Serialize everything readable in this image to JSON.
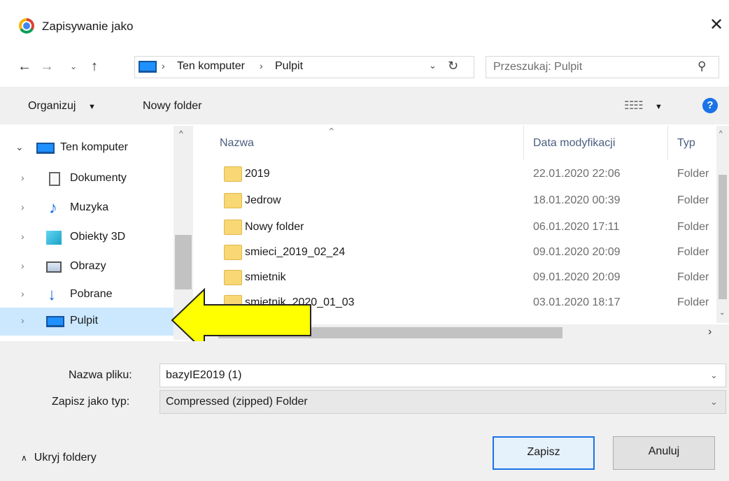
{
  "window": {
    "title": "Zapisywanie jako",
    "close": "✕"
  },
  "nav": {
    "back": "←",
    "forward": "→",
    "recent": "⌄",
    "up": "↑"
  },
  "address": {
    "crumbs": [
      "Ten komputer",
      "Pulpit"
    ],
    "separator": "›",
    "dropdown": "⌄",
    "refresh": "↻"
  },
  "search": {
    "placeholder": "Przeszukaj: Pulpit",
    "value": ""
  },
  "toolbar": {
    "organize": "Organizuj",
    "caret": "▼",
    "new_folder": "Nowy folder",
    "view": "☷☷"
  },
  "tree": {
    "root": "Ten komputer",
    "items": [
      {
        "label": "Dokumenty",
        "icon": "document-icon"
      },
      {
        "label": "Muzyka",
        "icon": "music-note-icon"
      },
      {
        "label": "Obiekty 3D",
        "icon": "cube-icon"
      },
      {
        "label": "Obrazy",
        "icon": "image-icon"
      },
      {
        "label": "Pobrane",
        "icon": "download-arrow-icon"
      },
      {
        "label": "Pulpit",
        "icon": "desktop-monitor-icon",
        "selected": true
      }
    ]
  },
  "columns": {
    "name": "Nazwa",
    "date": "Data modyfikacji",
    "type": "Typ"
  },
  "files": [
    {
      "name": "2019",
      "date": "22.01.2020 22:06",
      "type": "Folder"
    },
    {
      "name": "Jedrow",
      "date": "18.01.2020 00:39",
      "type": "Folder"
    },
    {
      "name": "Nowy folder",
      "date": "06.01.2020 17:11",
      "type": "Folder"
    },
    {
      "name": "smieci_2019_02_24",
      "date": "09.01.2020 20:09",
      "type": "Folder"
    },
    {
      "name": "smietnik",
      "date": "09.01.2020 20:09",
      "type": "Folder"
    },
    {
      "name": "smietnik_2020_01_03",
      "date": "03.01.2020 18:17",
      "type": "Folder"
    }
  ],
  "form": {
    "filename_label": "Nazwa pliku:",
    "filename_value": "bazyIE2019 (1)",
    "filetype_label": "Zapisz jako typ:",
    "filetype_value": "Compressed (zipped) Folder"
  },
  "footer": {
    "hide_folders": "Ukryj foldery",
    "save": "Zapisz",
    "cancel": "Anuluj"
  },
  "colors": {
    "selection": "#cce8ff",
    "accent": "#1a73e8",
    "arrow_fill": "#ffff00"
  }
}
